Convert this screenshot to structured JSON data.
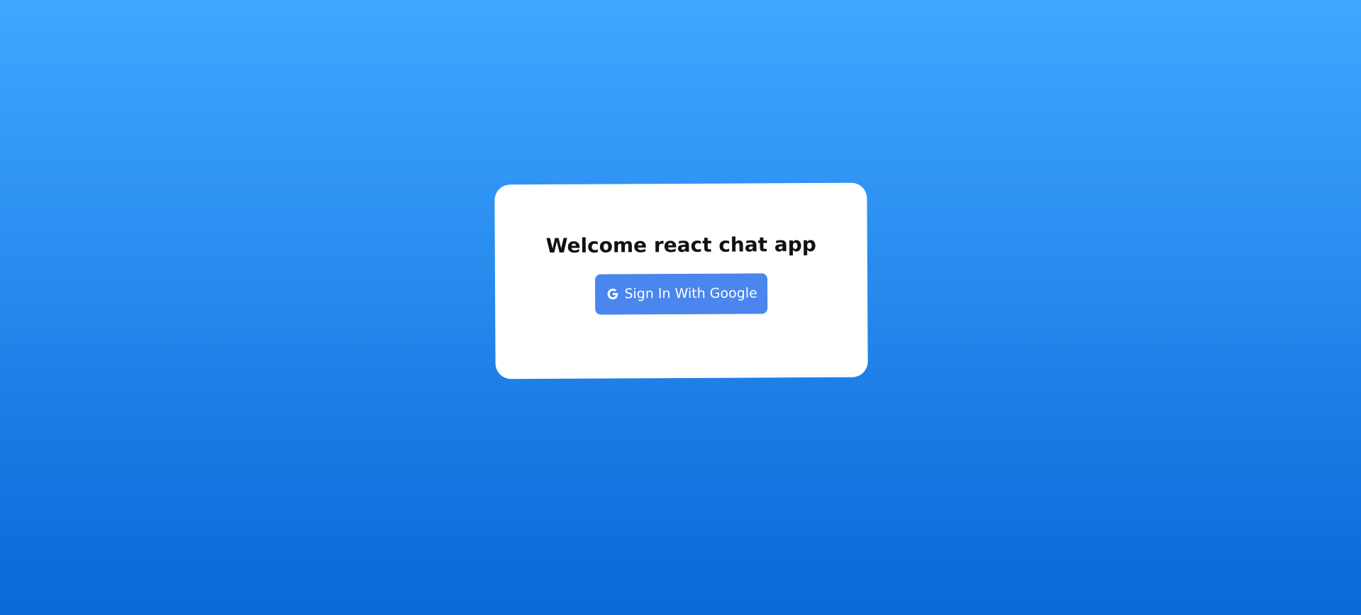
{
  "login": {
    "title": "Welcome react chat app",
    "button_label": "Sign In With Google",
    "button_icon": "google-icon"
  },
  "colors": {
    "background_top": "#3fa7ff",
    "background_bottom": "#0b68d8",
    "card": "#ffffff",
    "button": "#4a86ee",
    "button_text": "#ffffff",
    "title_text": "#111111"
  }
}
